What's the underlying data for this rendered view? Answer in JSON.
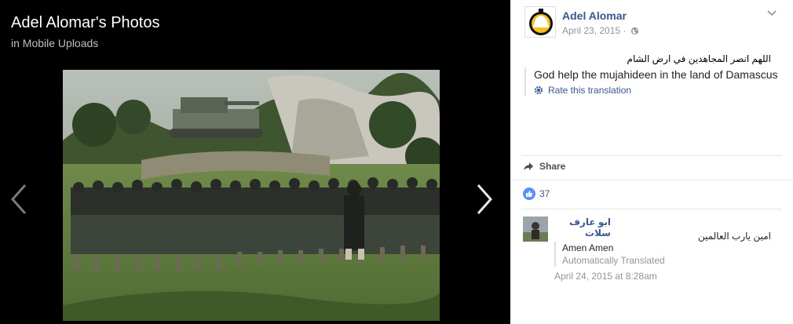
{
  "viewer": {
    "title": "Adel Alomar's Photos",
    "subtitle": "in Mobile Uploads",
    "prev_icon": "chevron-left-icon",
    "next_icon": "chevron-right-icon"
  },
  "post": {
    "author": "Adel Alomar",
    "date": "April 23, 2015 ·",
    "privacy_icon": "globe-icon",
    "original_text": "اللهم انصر المجاهدين في ارض الشام",
    "translated_text": "God help the mujahideen in the land of Damascus",
    "rate_translation": "Rate this translation",
    "share_label": "Share",
    "like_count": "37"
  },
  "comment": {
    "author": "ابو عارف سلات",
    "text": "امين يارب العالمين",
    "translation": "Amen Amen",
    "translation_note": "Automatically Translated",
    "timestamp": "April 24, 2015 at 8:28am"
  },
  "colors": {
    "link": "#365899",
    "muted": "#90949c",
    "like_blue": "#5890ff"
  }
}
